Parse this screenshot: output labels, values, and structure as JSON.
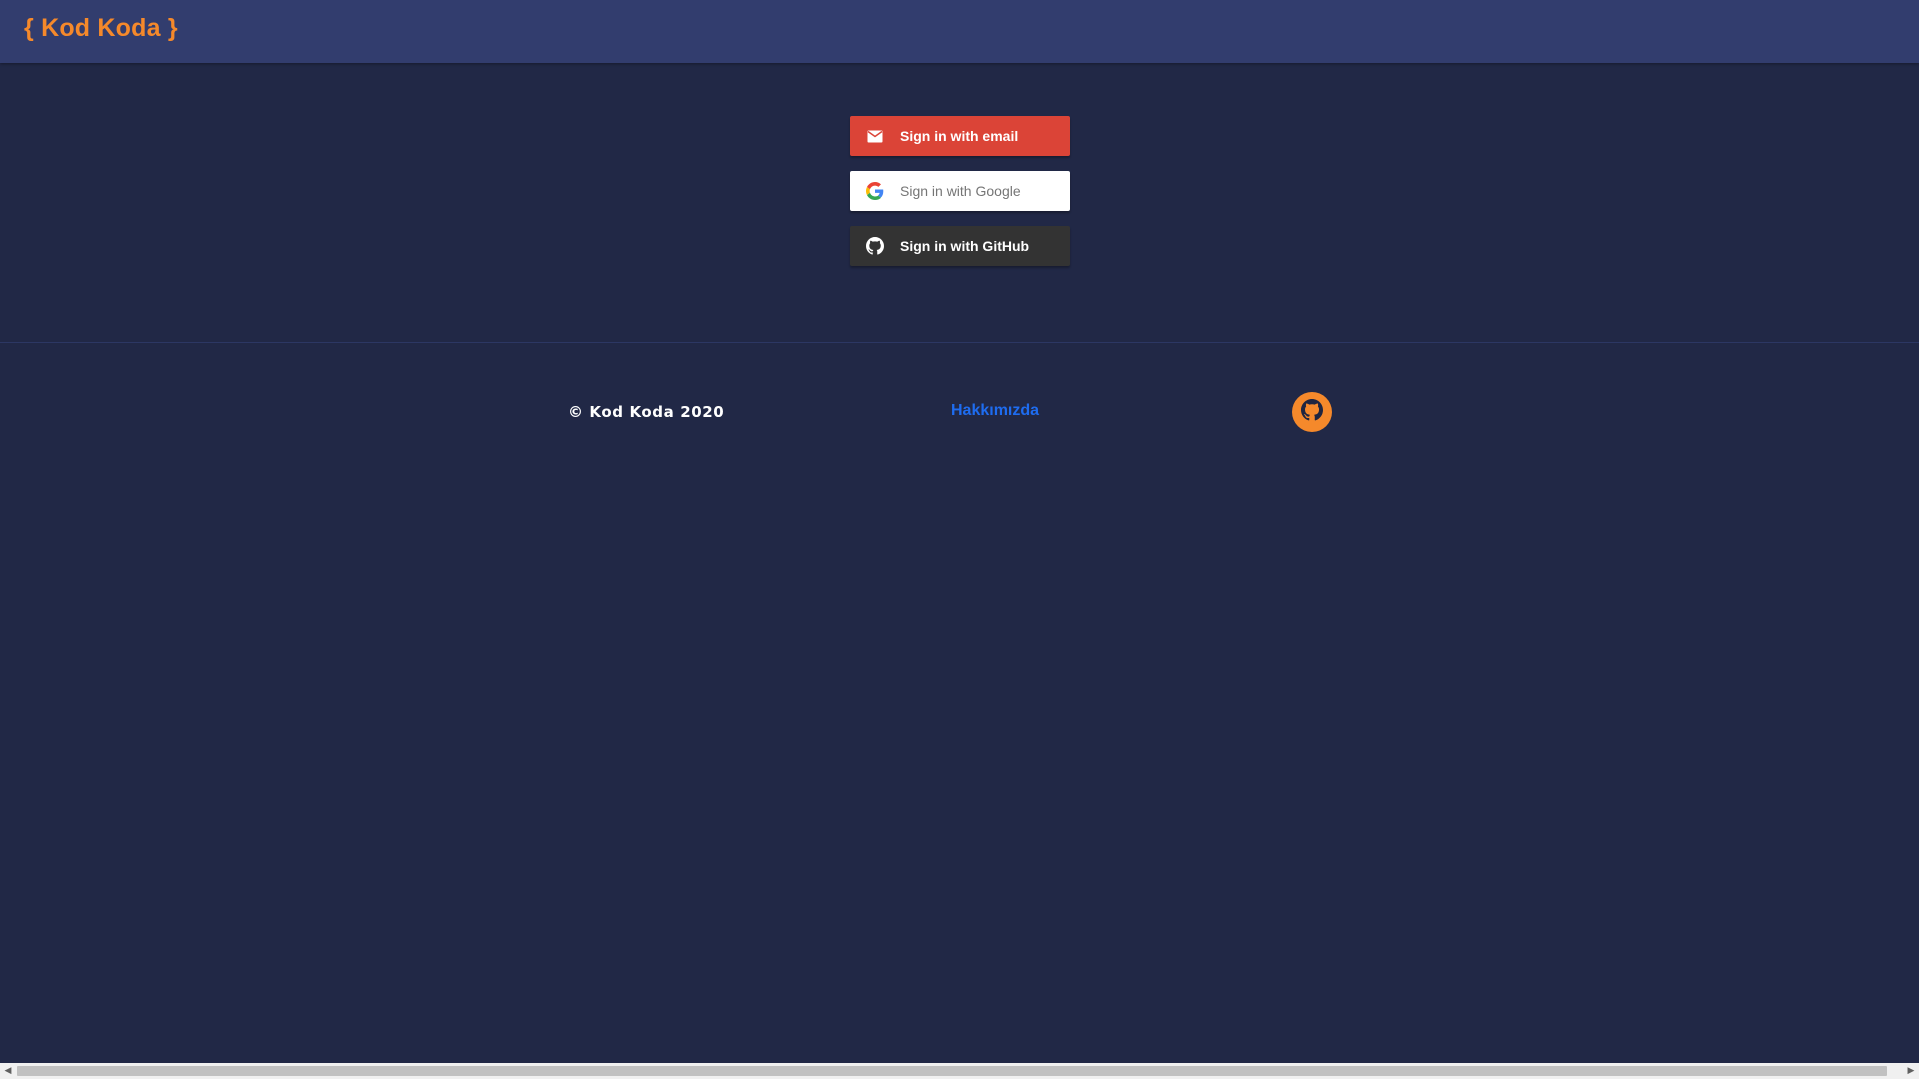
{
  "header": {
    "brand": "{ Kod Koda }"
  },
  "auth": {
    "email_label": "Sign in with email",
    "google_label": "Sign in with Google",
    "github_label": "Sign in with GitHub"
  },
  "footer": {
    "copyright": "© Kod Koda 2020",
    "about_link": "Hakkımızda",
    "github_icon": "github-icon"
  },
  "icons": {
    "email": "mail-icon",
    "google": "google-icon",
    "github": "github-icon"
  },
  "colors": {
    "background": "#212846",
    "header": "#323d6e",
    "brand": "#f5892b",
    "email_button": "#db4437",
    "google_button": "#ffffff",
    "github_button": "#333333",
    "link": "#1e6cf0"
  }
}
